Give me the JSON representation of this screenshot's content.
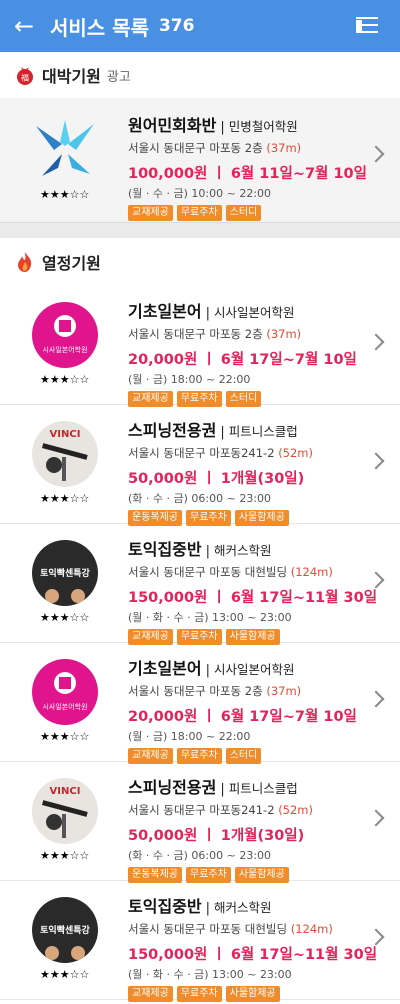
{
  "header": {
    "back_icon": "arrow-left-icon",
    "title": "서비스 목록",
    "count": "376",
    "menu_icon": "list-menu-icon"
  },
  "ad_section": {
    "title": "대박기원",
    "sub": "광고",
    "icon": "lucky-bag-icon",
    "icon_text": "福"
  },
  "hot_section": {
    "title": "열정기원",
    "icon": "fire-icon"
  },
  "ad_item": {
    "name": "원어민회화반",
    "org": "민병철어학원",
    "addr": "서울시 동대문구 마포동 2층",
    "dist": "(37m)",
    "price": "100,000원 ㅣ 6월 11일~7월 10일",
    "time": "(월 · 수 · 금) 10:00 ~ 22:00",
    "tags": [
      "교재제공",
      "무료주차",
      "스터디"
    ],
    "stars": "★★★☆☆"
  },
  "items": [
    {
      "name": "기초일본어",
      "org": "시사일본어학원",
      "addr": "서울시 동대문구 마포동 2층",
      "dist": "(37m)",
      "price": "20,000원 ㅣ 6월 17일~7월 10일",
      "time": "(월 · 금) 18:00 ~ 22:00",
      "tags": [
        "교재제공",
        "무료주차",
        "스터디"
      ],
      "stars": "★★★☆☆",
      "thumb_text": "시사일본어학원"
    },
    {
      "name": "스피닝전용권",
      "org": "피트니스클럽",
      "addr": "서울시 동대문구 마포동241-2",
      "dist": "(52m)",
      "price": "50,000원 ㅣ 1개월(30일)",
      "time": "(화 · 수 · 금) 06:00 ~ 23:00",
      "tags": [
        "운동복제공",
        "무료주차",
        "사물함제공"
      ],
      "stars": "★★★☆☆",
      "thumb_text": "VINCI"
    },
    {
      "name": "토익집중반",
      "org": "해커스학원",
      "addr": "서울시 동대문구 마포동 대현빌딩",
      "dist": "(124m)",
      "price": "150,000원 ㅣ 6월 17일~11월 30일",
      "time": "(월 · 화 · 수 · 금) 13:00 ~ 23:00",
      "tags": [
        "교재제공",
        "무료주차",
        "사물함제공"
      ],
      "stars": "★★★☆☆",
      "thumb_text": "토익빡센특강"
    },
    {
      "name": "기초일본어",
      "org": "시사일본어학원",
      "addr": "서울시 동대문구 마포동 2층",
      "dist": "(37m)",
      "price": "20,000원 ㅣ 6월 17일~7월 10일",
      "time": "(월 · 금) 18:00 ~ 22:00",
      "tags": [
        "교재제공",
        "무료주차",
        "스터디"
      ],
      "stars": "★★★☆☆",
      "thumb_text": "시사일본어학원"
    },
    {
      "name": "스피닝전용권",
      "org": "피트니스클럽",
      "addr": "서울시 동대문구 마포동241-2",
      "dist": "(52m)",
      "price": "50,000원 ㅣ 1개월(30일)",
      "time": "(화 · 수 · 금) 06:00 ~ 23:00",
      "tags": [
        "운동복제공",
        "무료주차",
        "사물함제공"
      ],
      "stars": "★★★☆☆",
      "thumb_text": "VINCI"
    },
    {
      "name": "토익집중반",
      "org": "해커스학원",
      "addr": "서울시 동대문구 마포동 대현빌딩",
      "dist": "(124m)",
      "price": "150,000원 ㅣ 6월 17일~11월 30일",
      "time": "(월 · 화 · 수 · 금) 13:00 ~ 23:00",
      "tags": [
        "교재제공",
        "무료주차",
        "사물함제공"
      ],
      "stars": "★★★☆☆",
      "thumb_text": "토익빡센특강"
    }
  ]
}
